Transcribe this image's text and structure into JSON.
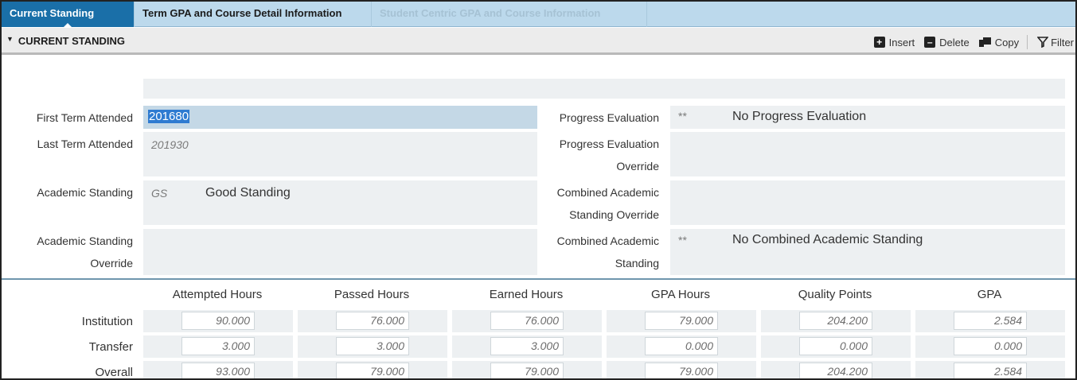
{
  "tabs": [
    {
      "label": "Current Standing",
      "state": "active"
    },
    {
      "label": "Term GPA and Course Detail Information",
      "state": "normal"
    },
    {
      "label": "Student Centric GPA and Course Information",
      "state": "disabled"
    }
  ],
  "section": {
    "title": "CURRENT STANDING",
    "toolbar": {
      "insert": "Insert",
      "delete": "Delete",
      "copy": "Copy",
      "filter": "Filter"
    }
  },
  "form": {
    "first_term_label": "First Term Attended",
    "first_term_value": "201680",
    "last_term_label": "Last Term Attended",
    "last_term_value": "201930",
    "academic_standing_label": "Academic Standing",
    "academic_standing_code": "GS",
    "academic_standing_desc": "Good Standing",
    "academic_standing_override_label_1": "Academic Standing",
    "academic_standing_override_label_2": "Override",
    "progress_eval_label": "Progress Evaluation",
    "progress_eval_code": "**",
    "progress_eval_desc": "No Progress Evaluation",
    "progress_eval_override_label_1": "Progress Evaluation",
    "progress_eval_override_label_2": "Override",
    "combined_override_label_1": "Combined Academic",
    "combined_override_label_2": "Standing Override",
    "combined_label_1": "Combined Academic",
    "combined_label_2": "Standing",
    "combined_code": "**",
    "combined_desc": "No Combined Academic Standing"
  },
  "hours": {
    "columns": [
      "Attempted Hours",
      "Passed Hours",
      "Earned Hours",
      "GPA Hours",
      "Quality Points",
      "GPA"
    ],
    "rows": [
      {
        "label": "Institution",
        "values": [
          "90.000",
          "76.000",
          "76.000",
          "79.000",
          "204.200",
          "2.584"
        ]
      },
      {
        "label": "Transfer",
        "values": [
          "3.000",
          "3.000",
          "3.000",
          "0.000",
          "0.000",
          "0.000"
        ]
      },
      {
        "label": "Overall",
        "values": [
          "93.000",
          "79.000",
          "79.000",
          "79.000",
          "204.200",
          "2.584"
        ]
      }
    ]
  },
  "colors": {
    "active_tab": "#1a6fa8",
    "tab_bar": "#bcd9ec",
    "field_bg": "#edf0f2",
    "selection": "#2e7bd1"
  }
}
